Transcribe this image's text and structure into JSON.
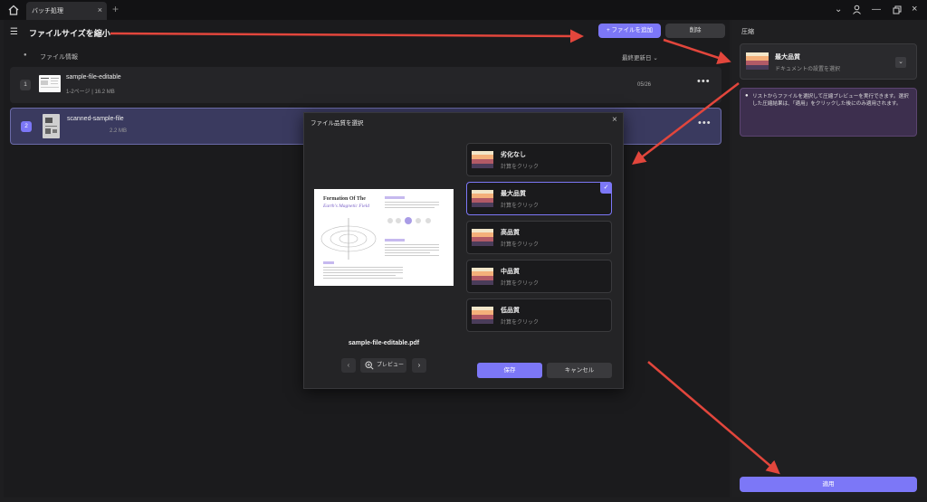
{
  "titlebar": {
    "tab_label": "バッチ処理",
    "tab_close": "×",
    "tab_add": "+",
    "home_icon": "home-icon"
  },
  "left": {
    "title": "ファイルサイズを縮小",
    "add_button": "ファイルを追加",
    "delete_button": "削除",
    "col_info": "ファイル情報",
    "col_date": "最終更新日",
    "col_date_caret": "⌄",
    "rows": [
      {
        "num": "1",
        "name": "sample-file-editable",
        "meta": "1-2ページ | 16.2 MB",
        "date": "05/26",
        "selected": false
      },
      {
        "num": "2",
        "name": "scanned-sample-file",
        "meta": "2.2 MB",
        "date": "",
        "selected": true
      }
    ]
  },
  "right": {
    "title": "圧縮",
    "quality_name": "最大品質",
    "quality_desc": "ドキュメントの設置を選択",
    "info": "リストからファイルを選択して圧縮プレビューを実行できます。選択した圧縮結果は、「適用」をクリックした後にのみ適用されます。",
    "apply": "適用"
  },
  "modal": {
    "title": "ファイル品質を選択",
    "close": "×",
    "doc_title_1": "Formation Of The",
    "doc_title_2": "Earth's Magnetic Field",
    "file_name": "sample-file-editable.pdf",
    "preview_label": "プレビュー",
    "prev": "‹",
    "next": "›",
    "options": [
      {
        "name": "劣化なし",
        "desc": "計算をクリック",
        "selected": false
      },
      {
        "name": "最大品質",
        "desc": "計算をクリック",
        "selected": true
      },
      {
        "name": "高品質",
        "desc": "計算をクリック",
        "selected": false
      },
      {
        "name": "中品質",
        "desc": "計算をクリック",
        "selected": false
      },
      {
        "name": "低品質",
        "desc": "計算をクリック",
        "selected": false
      }
    ],
    "check": "✓",
    "save": "保存",
    "cancel": "キャンセル"
  },
  "colors": {
    "accent": "#7c77f7",
    "background": "#1e1e20",
    "annotation_arrow": "#e2463c"
  }
}
